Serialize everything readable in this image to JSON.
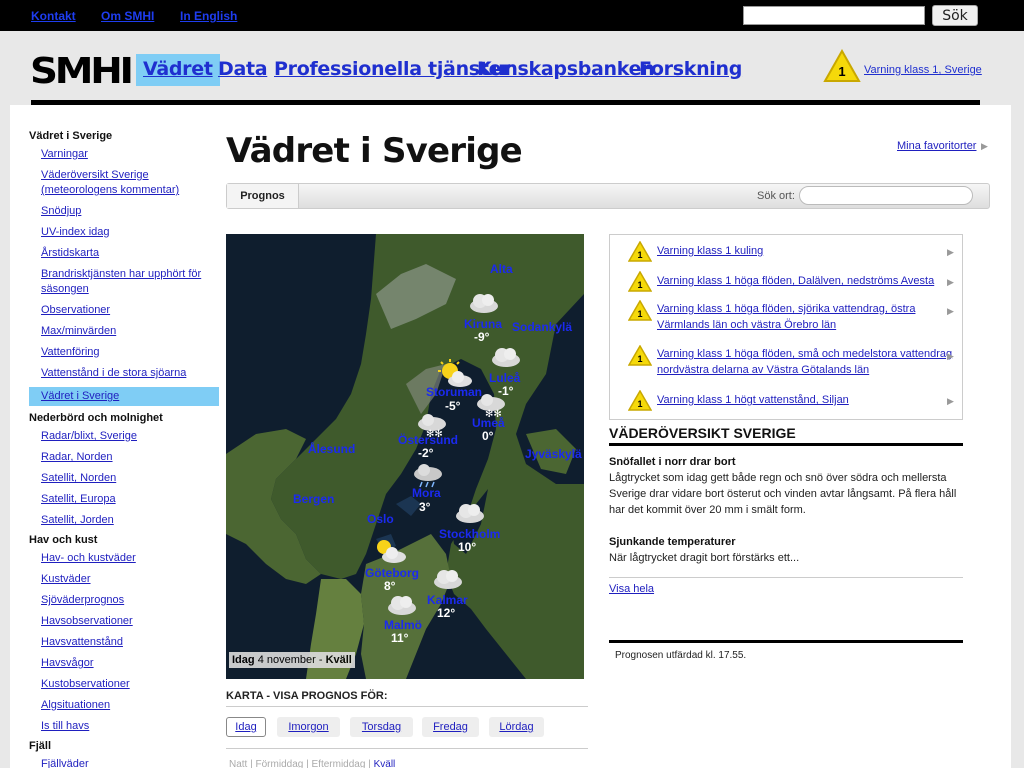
{
  "topbar": {
    "links": [
      "Kontakt",
      "Om SMHI",
      "In English"
    ],
    "search_button": "Sök"
  },
  "header": {
    "logo": "SMHI",
    "nav": [
      "Vädret",
      "Data",
      "Professionella tjänster",
      "Kunskapsbanken",
      "Forskning"
    ],
    "warning_number": "1",
    "warning_link": "Varning klass 1, Sverige"
  },
  "sidebar": {
    "sections": [
      {
        "heading": "Vädret i Sverige",
        "items": [
          "Varningar",
          "Väderöversikt Sverige (meteorologens kommentar)",
          "Snödjup",
          "UV-index idag",
          "Årstidskarta",
          "Brandrisktjänsten har upphört för säsongen",
          "Observationer",
          "Max/minvärden",
          "Vattenföring",
          "Vattenstånd i de stora sjöarna",
          "Vädret i Sverige"
        ]
      },
      {
        "heading": "Nederbörd och molnighet",
        "items": [
          "Radar/blixt, Sverige",
          "Radar, Norden",
          "Satellit, Norden",
          "Satellit, Europa",
          "Satellit, Jorden"
        ]
      },
      {
        "heading": "Hav och kust",
        "items": [
          "Hav- och kustväder",
          "Kustväder",
          "Sjöväderprognos",
          "Havsobservationer",
          "Havsvattenstånd",
          "Havsvågor",
          "Kustobservationer",
          "Algsituationen",
          "Is till havs"
        ]
      },
      {
        "heading": "Fjäll",
        "items": [
          "Fjällväder"
        ]
      }
    ]
  },
  "main": {
    "title": "Vädret i Sverige",
    "favorites_link": "Mina favoritorter",
    "tab": "Prognos",
    "search_label": "Sök ort:"
  },
  "map": {
    "places": [
      {
        "name": "Alta",
        "temp": ""
      },
      {
        "name": "Kiruna",
        "temp": "-9°"
      },
      {
        "name": "Sodankylä",
        "temp": ""
      },
      {
        "name": "Luleå",
        "temp": "-1°"
      },
      {
        "name": "Storuman",
        "temp": "-5°"
      },
      {
        "name": "Umeå",
        "temp": "0°"
      },
      {
        "name": "Östersund",
        "temp": "-2°"
      },
      {
        "name": "Ålesund",
        "temp": ""
      },
      {
        "name": "Jyväskylä",
        "temp": ""
      },
      {
        "name": "Mora",
        "temp": "3°"
      },
      {
        "name": "Bergen",
        "temp": ""
      },
      {
        "name": "Oslo",
        "temp": ""
      },
      {
        "name": "Stockholm",
        "temp": "10°"
      },
      {
        "name": "Göteborg",
        "temp": "8°"
      },
      {
        "name": "Kalmar",
        "temp": "12°"
      },
      {
        "name": "Malmö",
        "temp": "11°"
      }
    ],
    "caption_day": "Idag",
    "caption_date": "4 november",
    "caption_sep": " - ",
    "caption_period": "Kväll"
  },
  "forecast_controls": {
    "label": "KARTA - VISA PROGNOS FÖR:",
    "days": [
      "Idag",
      "Imorgon",
      "Torsdag",
      "Fredag",
      "Lördag"
    ],
    "times": [
      "Natt",
      "Förmiddag",
      "Eftermiddag",
      "Kväll"
    ],
    "time_sep": "|"
  },
  "warnings": [
    "Varning klass 1 kuling",
    "Varning klass 1 höga flöden, Dalälven, nedströms Avesta",
    "Varning klass 1 höga flöden, sjörika vattendrag, östra Värmlands län och västra Örebro län",
    "Varning klass 1 höga flöden, små och medelstora vattendrag nordvästra delarna av Västra Götalands län",
    "Varning klass 1 högt vattenstånd, Siljan"
  ],
  "overview": {
    "title": "VÄDERÖVERSIKT SVERIGE",
    "h1": "Snöfallet i norr drar bort",
    "p1": "Lågtrycket som idag gett både regn och snö över södra och mellersta Sverige drar vidare bort österut och vinden avtar långsamt. På flera håll har det kommit över 20 mm i smält form.",
    "h2": "Sjunkande temperaturer",
    "p2": "När lågtrycket dragit bort förstärks ett...",
    "more_link": "Visa hela",
    "issued": "Prognosen utfärdad kl. 17.55."
  },
  "colors": {
    "accent": "#7fcdf5",
    "link": "#1f1fbf",
    "warning_yellow": "#f5d90a"
  }
}
